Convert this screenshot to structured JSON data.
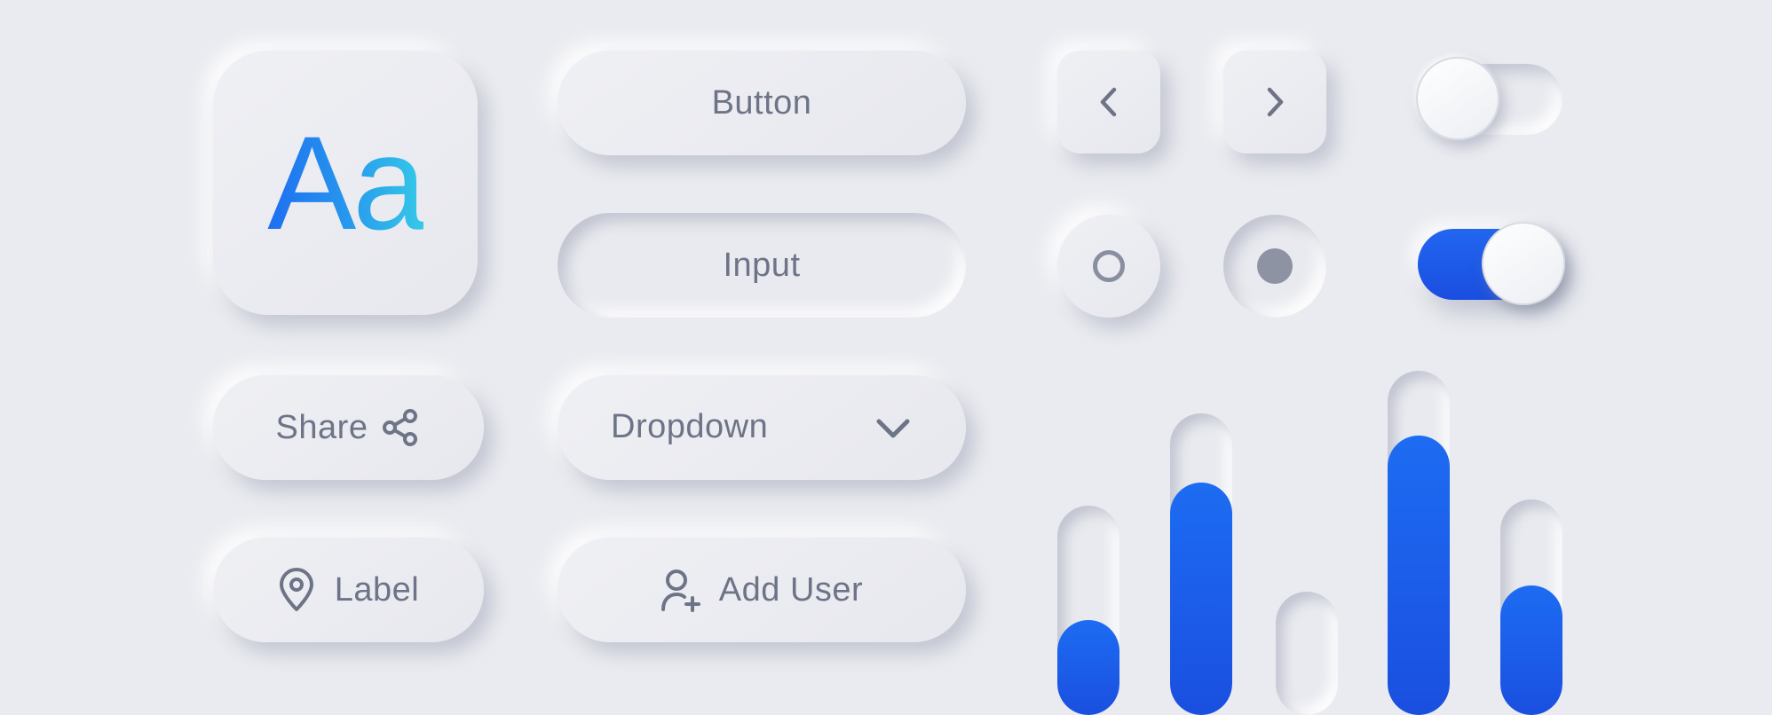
{
  "typography_tile": {
    "text": "Aa"
  },
  "buttons": {
    "button_label": "Button",
    "input_label": "Input",
    "share_label": "Share",
    "dropdown_label": "Dropdown",
    "label_label": "Label",
    "add_user_label": "Add User"
  },
  "icons": {
    "share": "share-icon",
    "dropdown": "chevron-down-icon",
    "label": "map-pin-icon",
    "add_user": "user-plus-icon",
    "prev": "chevron-left-icon",
    "next": "chevron-right-icon"
  },
  "radios": {
    "unselected": false,
    "selected": true
  },
  "toggles": {
    "top_on": false,
    "bottom_on": true
  },
  "sliders": {
    "fill_fractions": [
      0.34,
      0.74,
      0.0,
      0.79,
      0.52
    ]
  },
  "colors": {
    "background": "#eaebf0",
    "accent_blue": "#1a5ef0",
    "text_gray": "#6e7487",
    "gradient_start": "#1f6ef0",
    "gradient_end": "#35c9e8"
  }
}
